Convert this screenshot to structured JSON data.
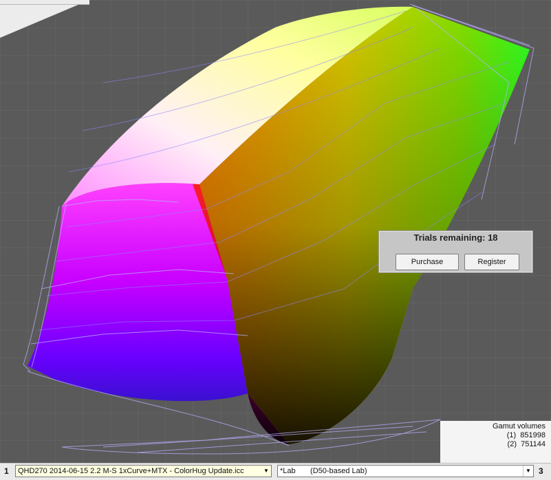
{
  "trial": {
    "title": "Trials remaining: 18",
    "purchase_label": "Purchase",
    "register_label": "Register"
  },
  "gamut": {
    "heading": "Gamut volumes",
    "entries": [
      "(1)  851998",
      "(2)  751144"
    ]
  },
  "bottom": {
    "left_number": "1",
    "right_number": "3",
    "profile_value": "QHD270 2014-06-15 2.2 M-S 1xCurve+MTX - ColorHug Update.icc",
    "colorspace_value": "*Lab       (D50-based Lab)"
  },
  "colors": {
    "background": "#5a5a5a",
    "dialog": "#c6c6c6",
    "profile_field": "#ffffe1"
  }
}
